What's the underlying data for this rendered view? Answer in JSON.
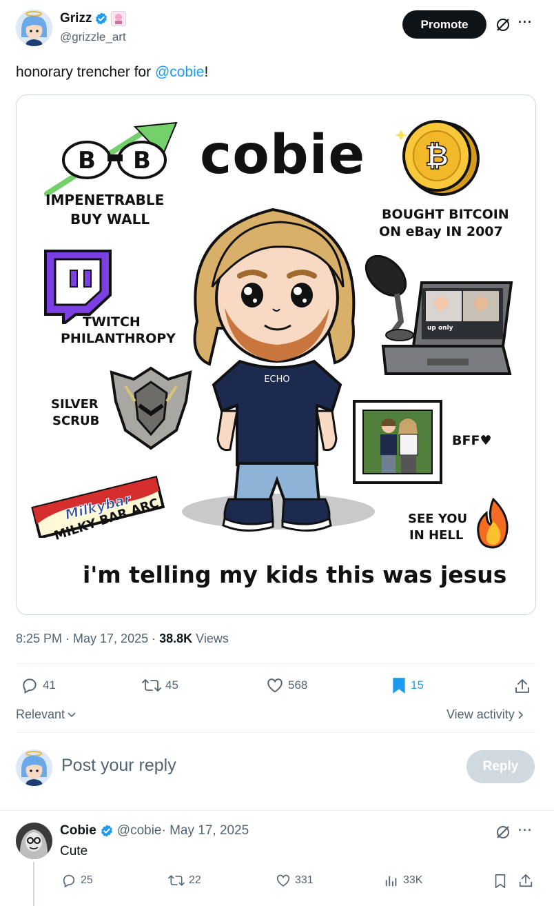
{
  "author": {
    "name": "Grizz",
    "handle": "@grizzle_art",
    "verified": true
  },
  "header": {
    "promote_label": "Promote",
    "more_label": "···"
  },
  "tweet": {
    "text_prefix": "honorary trencher for ",
    "mention": "@cobie",
    "text_suffix": "!",
    "timestamp": "8:25 PM · May 17, 2025 · ",
    "views_count": "38.8K",
    "views_label": " Views"
  },
  "image": {
    "title": "cobie",
    "shirt_text": "ECHO",
    "screen_text": "up only",
    "labels": {
      "buy_wall_1": "IMPENETRABLE",
      "buy_wall_2": "BUY WALL",
      "bitcoin_1": "BOUGHT BITCOIN",
      "bitcoin_2": "ON eBay IN 2007",
      "twitch_1": "TWITCH",
      "twitch_2": "PHILANTHROPY",
      "silver_1": "SILVER",
      "silver_2": "SCRUB",
      "bff": "BFF♥",
      "milky": "MILKY BAR ARC",
      "milkybar_logo": "Milkybar",
      "hell_1": "SEE YOU",
      "hell_2": "IN HELL",
      "caption": "i'm telling my kids this was jesus"
    }
  },
  "actions": {
    "replies": "41",
    "reposts": "45",
    "likes": "568",
    "bookmarks": "15"
  },
  "sort": {
    "label": "Relevant",
    "view_activity": "View activity"
  },
  "composer": {
    "placeholder": "Post your reply",
    "reply_button": "Reply"
  },
  "reply": {
    "name": "Cobie",
    "handle": "@cobie",
    "date": " · May 17, 2025",
    "text": "Cute",
    "replies": "25",
    "reposts": "22",
    "likes": "331",
    "views": "33K"
  },
  "colors": {
    "accent": "#1d9bf0",
    "promote_bg": "#0f1419",
    "reply_disabled": "#cfd9de",
    "border": "#eff3f4"
  }
}
